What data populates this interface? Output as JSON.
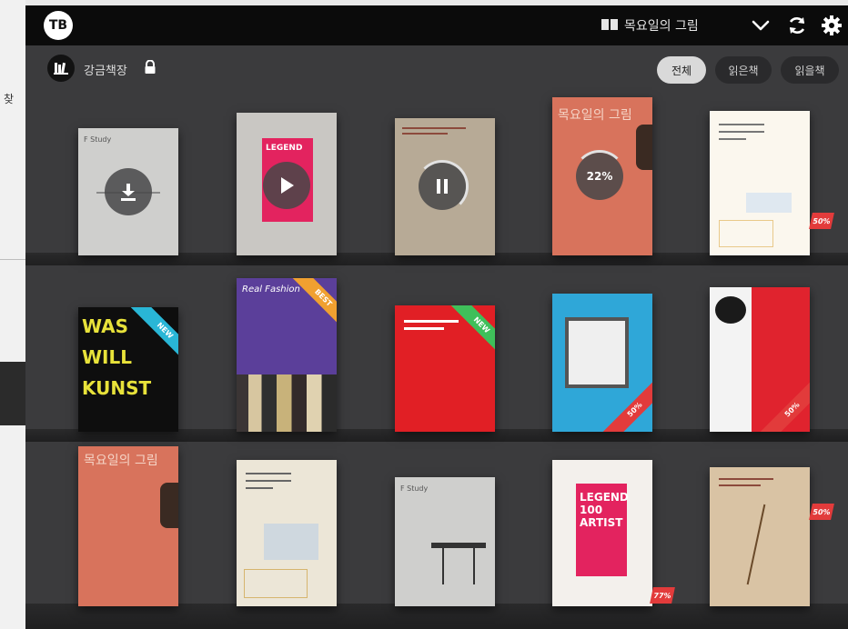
{
  "background_app": {
    "partial_text": "찾"
  },
  "topbar": {
    "logo_text": "TB",
    "current_book_title": "목요일의 그림",
    "icons": [
      "book-icon",
      "chevron-down-icon",
      "refresh-icon",
      "gear-icon"
    ]
  },
  "shelf": {
    "name": "강금책장",
    "locked": true,
    "filters": [
      {
        "label": "전체",
        "active": true
      },
      {
        "label": "읽은책",
        "active": false
      },
      {
        "label": "읽을책",
        "active": false
      }
    ]
  },
  "books": [
    {
      "row": 0,
      "title": "F Study",
      "sub": "",
      "overlay": "download-icon"
    },
    {
      "row": 0,
      "title": "LEGEND",
      "sub": "",
      "overlay": "play-icon"
    },
    {
      "row": 0,
      "title": "",
      "sub": "",
      "overlay": "pause-icon"
    },
    {
      "row": 0,
      "title": "목요일의 그림",
      "sub": "",
      "overlay_text": "22%"
    },
    {
      "row": 0,
      "title": "",
      "sub": "",
      "sale": "50%"
    },
    {
      "row": 1,
      "title": "WAS WILL KUNST",
      "sub": "",
      "ribbon": "NEW"
    },
    {
      "row": 1,
      "title": "Real Fashion",
      "sub": "",
      "ribbon": "BEST"
    },
    {
      "row": 1,
      "title": "",
      "sub": "",
      "ribbon": "NEW"
    },
    {
      "row": 1,
      "title": "",
      "sub": "",
      "ribbon": "50%"
    },
    {
      "row": 1,
      "title": "",
      "sub": "",
      "ribbon": "50%"
    },
    {
      "row": 2,
      "title": "목요일의 그림",
      "sub": ""
    },
    {
      "row": 2,
      "title": "",
      "sub": ""
    },
    {
      "row": 2,
      "title": "F Study",
      "sub": ""
    },
    {
      "row": 2,
      "title": "LEGEND 100 ARTIST",
      "sub": "",
      "sale": "77%"
    },
    {
      "row": 2,
      "title": "",
      "sub": "",
      "sale": "50%"
    }
  ],
  "colors": {
    "topbar": "#0b0b0b",
    "shelf_bg": "#3b3b3d",
    "accent_red": "#e23b3b",
    "ribbon_cyan": "#29b6d6",
    "ribbon_orange": "#f0a030",
    "ribbon_green": "#3fbf5a"
  }
}
